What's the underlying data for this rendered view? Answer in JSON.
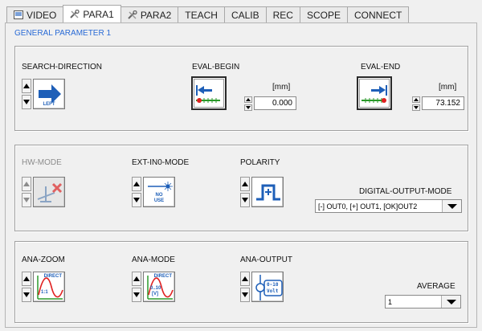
{
  "tabs": [
    {
      "label": "VIDEO",
      "icon": "video-icon",
      "active": false
    },
    {
      "label": "PARA1",
      "icon": "tools-icon",
      "active": true
    },
    {
      "label": "PARA2",
      "icon": "tools-icon",
      "active": false
    },
    {
      "label": "TEACH",
      "icon": "",
      "active": false
    },
    {
      "label": "CALIB",
      "icon": "",
      "active": false
    },
    {
      "label": "REC",
      "icon": "",
      "active": false
    },
    {
      "label": "SCOPE",
      "icon": "",
      "active": false
    },
    {
      "label": "CONNECT",
      "icon": "",
      "active": false
    }
  ],
  "page_title": "GENERAL PARAMETER 1",
  "group1": {
    "search_direction": {
      "label": "SEARCH-DIRECTION",
      "icon_text": "LEFT"
    },
    "eval_begin": {
      "label": "EVAL-BEGIN",
      "unit": "[mm]",
      "value": "0.000"
    },
    "eval_end": {
      "label": "EVAL-END",
      "unit": "[mm]",
      "value": "73.152"
    }
  },
  "group2": {
    "hw_mode": {
      "label": "HW-MODE"
    },
    "ext_in0_mode": {
      "label": "EXT-IN0-MODE",
      "icon_text_1": "NO",
      "icon_text_2": "USE"
    },
    "polarity": {
      "label": "POLARITY"
    },
    "digital_output_mode": {
      "label": "DIGITAL-OUTPUT-MODE",
      "value": "[-] OUT0, [+] OUT1, [OK]OUT2"
    }
  },
  "group3": {
    "ana_zoom": {
      "label": "ANA-ZOOM",
      "icon_text_1": "DIRECT",
      "icon_text_2": "1:1"
    },
    "ana_mode": {
      "label": "ANA-MODE",
      "icon_text_1": "DIRECT",
      "icon_text_2": "0..10",
      "icon_text_3": "[V]"
    },
    "ana_output": {
      "label": "ANA-OUTPUT",
      "icon_text_1": "0-10",
      "icon_text_2": "Volt"
    },
    "average": {
      "label": "AVERAGE",
      "value": "1"
    }
  },
  "colors": {
    "accent_blue": "#2a6bd6",
    "arrow_blue": "#1e5fb8",
    "marker_red": "#e02020",
    "scale_green": "#2a9a2a"
  }
}
